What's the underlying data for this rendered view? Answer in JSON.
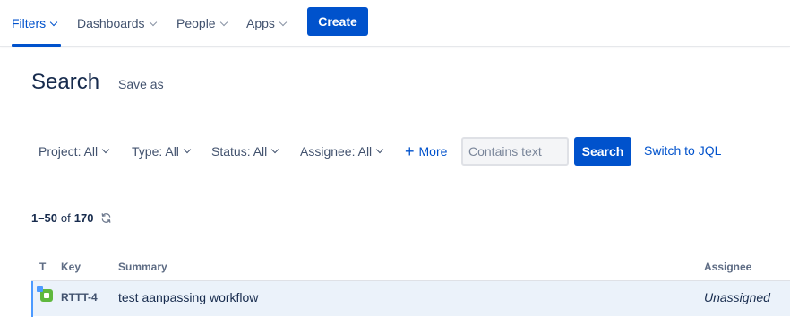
{
  "nav": {
    "items": [
      {
        "label": "Filters",
        "active": true
      },
      {
        "label": "Dashboards",
        "active": false
      },
      {
        "label": "People",
        "active": false
      },
      {
        "label": "Apps",
        "active": false
      }
    ],
    "create_label": "Create"
  },
  "page": {
    "title": "Search",
    "save_as_label": "Save as"
  },
  "filters": {
    "project": "Project: All",
    "type": "Type: All",
    "status": "Status: All",
    "assignee": "Assignee: All",
    "more": "More",
    "text_placeholder": "Contains text",
    "text_value": "",
    "search_label": "Search",
    "switch_jql_label": "Switch to JQL"
  },
  "results": {
    "range": "1–50",
    "of": "of",
    "total": "170"
  },
  "table": {
    "columns": {
      "type": "T",
      "key": "Key",
      "summary": "Summary",
      "assignee": "Assignee"
    },
    "rows": [
      {
        "key": "RTTT-4",
        "summary": "test aanpassing workflow",
        "assignee": "Unassigned",
        "type_icon": "story-icon"
      }
    ]
  },
  "colors": {
    "accent": "#0052cc",
    "row_selected": "#ebf2fa",
    "story_green": "#5fb83e"
  }
}
